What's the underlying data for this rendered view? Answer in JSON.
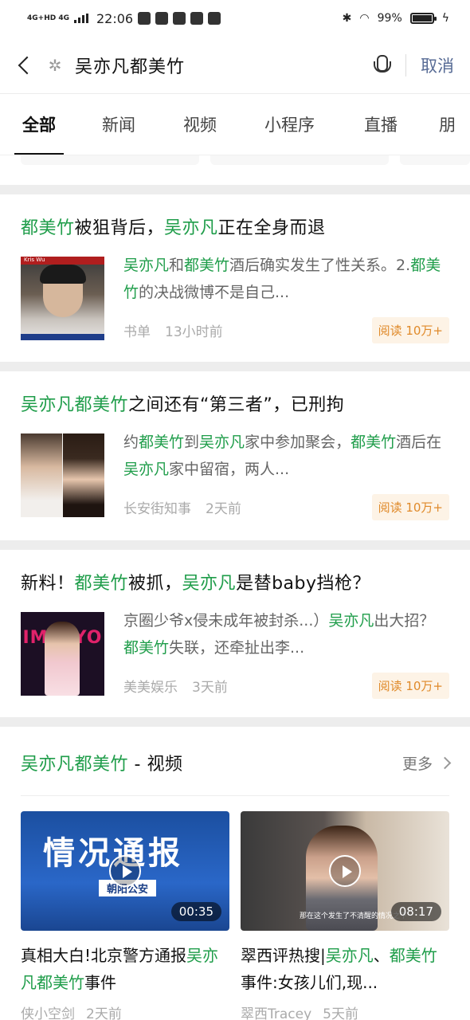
{
  "status_bar": {
    "network": "4G+HD 4G",
    "time": "22:06",
    "battery": "99%",
    "battery_level": 0.99
  },
  "search": {
    "query": "吴亦凡都美竹",
    "cancel_label": "取消"
  },
  "tabs": [
    "全部",
    "新闻",
    "视频",
    "小程序",
    "直播",
    "朋"
  ],
  "articles": [
    {
      "title": [
        {
          "t": "都美竹",
          "h": true
        },
        {
          "t": "被狙背后，",
          "h": false
        },
        {
          "t": "吴亦凡",
          "h": true
        },
        {
          "t": "正在全身而退",
          "h": false
        }
      ],
      "snippet": [
        {
          "t": "吴亦凡",
          "h": true
        },
        {
          "t": "和",
          "h": false
        },
        {
          "t": "都美竹",
          "h": true
        },
        {
          "t": "酒后确实发生了性关系。2.",
          "h": false
        },
        {
          "t": "都美竹",
          "h": true
        },
        {
          "t": "的决战微博不是自己...",
          "h": false
        }
      ],
      "source": "书单",
      "time": "13小时前",
      "reads": "阅读 10万+",
      "thumb_label": "Kris Wu"
    },
    {
      "title": [
        {
          "t": "吴亦凡都美竹",
          "h": true
        },
        {
          "t": "之间还有“第三者”，已刑拘",
          "h": false
        }
      ],
      "snippet": [
        {
          "t": "约",
          "h": false
        },
        {
          "t": "都美竹",
          "h": true
        },
        {
          "t": "到",
          "h": false
        },
        {
          "t": "吴亦凡",
          "h": true
        },
        {
          "t": "家中参加聚会，",
          "h": false
        },
        {
          "t": "都美竹",
          "h": true
        },
        {
          "t": "酒后在",
          "h": false
        },
        {
          "t": "吴亦凡",
          "h": true
        },
        {
          "t": "家中留宿，两人...",
          "h": false
        }
      ],
      "source": "长安街知事",
      "time": "2天前",
      "reads": "阅读 10万+",
      "thumb_label": ""
    },
    {
      "title": [
        {
          "t": "新料！",
          "h": false
        },
        {
          "t": "都美竹",
          "h": true
        },
        {
          "t": "被抓，",
          "h": false
        },
        {
          "t": "吴亦凡",
          "h": true
        },
        {
          "t": "是替baby挡枪？",
          "h": false
        }
      ],
      "snippet": [
        {
          "t": "京圈少爷x侵未成年被封杀...）",
          "h": false
        },
        {
          "t": "吴亦凡",
          "h": true
        },
        {
          "t": "出大招？",
          "h": false
        },
        {
          "t": "都美竹",
          "h": true
        },
        {
          "t": "失联，还牵扯出李...",
          "h": false
        }
      ],
      "source": "美美娱乐",
      "time": "3天前",
      "reads": "阅读 10万+",
      "thumb_label": "IMMIYO"
    }
  ],
  "video_section": {
    "title_keyword": "吴亦凡都美竹",
    "title_suffix": " - 视频",
    "more_label": "更多",
    "videos": [
      {
        "thumb_text": "情况通报",
        "thumb_sub": "朝阳公安",
        "duration": "00:35",
        "title": [
          {
            "t": "真相大白!北京警方通报",
            "h": false
          },
          {
            "t": "吴亦凡都美竹",
            "h": true
          },
          {
            "t": "事件",
            "h": false
          }
        ],
        "source": "侠小空剑",
        "time": "2天前"
      },
      {
        "thumb_text": "",
        "thumb_sub": "那在这个发生了不清醒的情况之下",
        "duration": "08:17",
        "title": [
          {
            "t": "翠西评热搜|",
            "h": false
          },
          {
            "t": "吴亦凡",
            "h": true
          },
          {
            "t": "、",
            "h": false
          },
          {
            "t": "都美竹",
            "h": true
          },
          {
            "t": "事件:女孩儿们,现...",
            "h": false
          }
        ],
        "source": "翠西Tracey",
        "time": "5天前"
      }
    ]
  },
  "colors": {
    "highlight": "#1f9d4a",
    "link": "#576b95",
    "badge": "#e08a2a"
  }
}
